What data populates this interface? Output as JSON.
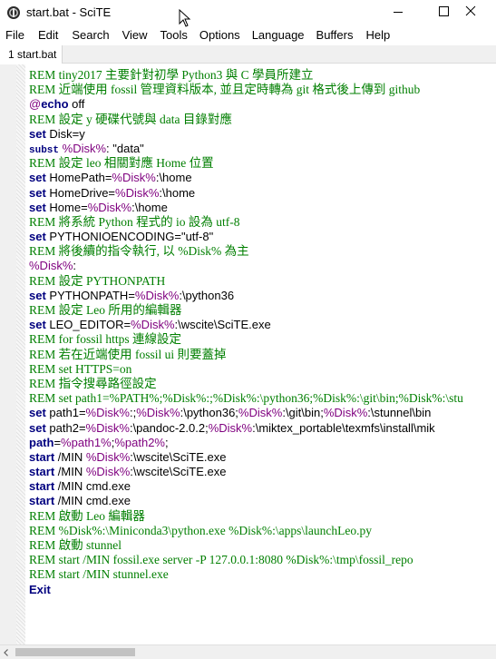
{
  "window": {
    "title": "start.bat - SciTE",
    "app_icon": "scite-app-icon",
    "controls": [
      "minimize-icon",
      "maximize-icon",
      "close-icon"
    ]
  },
  "menu": [
    "File",
    "Edit",
    "Search",
    "View",
    "Tools",
    "Options",
    "Language",
    "Buffers",
    "Help"
  ],
  "tabs": [
    {
      "label": "1 start.bat"
    }
  ],
  "colors": {
    "comment": "#007f00",
    "keyword": "#00007f",
    "variable": "#7f007f",
    "text": "#000000",
    "margin": "#f0f0f0"
  },
  "code_lines": [
    [
      {
        "t": "REM tiny2017 主要針對初學 Python3 與 C 學員所建立",
        "c": "comment"
      }
    ],
    [
      {
        "t": "REM 近端使用 fossil 管理資料版本, 並且定時轉為 git 格式後上傳到 github",
        "c": "comment"
      }
    ],
    [
      {
        "t": "@",
        "c": "var"
      },
      {
        "t": "echo",
        "c": "kw"
      },
      {
        "t": " off",
        "c": "text"
      }
    ],
    [
      {
        "t": "REM 設定 y 硬碟代號與 data 目錄對應",
        "c": "comment"
      }
    ],
    [
      {
        "t": "set",
        "c": "kw"
      },
      {
        "t": " Disk=y",
        "c": "text"
      }
    ],
    [
      {
        "t": "subst",
        "c": "kw2"
      },
      {
        "t": " ",
        "c": "text"
      },
      {
        "t": "%Disk%",
        "c": "var"
      },
      {
        "t": ": \"data\"",
        "c": "text"
      }
    ],
    [
      {
        "t": "REM 設定 leo 相關對應 Home 位置",
        "c": "comment"
      }
    ],
    [
      {
        "t": "set",
        "c": "kw"
      },
      {
        "t": " HomePath=",
        "c": "text"
      },
      {
        "t": "%Disk%",
        "c": "var"
      },
      {
        "t": ":\\home",
        "c": "text"
      }
    ],
    [
      {
        "t": "set",
        "c": "kw"
      },
      {
        "t": " HomeDrive=",
        "c": "text"
      },
      {
        "t": "%Disk%",
        "c": "var"
      },
      {
        "t": ":\\home",
        "c": "text"
      }
    ],
    [
      {
        "t": "set",
        "c": "kw"
      },
      {
        "t": " Home=",
        "c": "text"
      },
      {
        "t": "%Disk%",
        "c": "var"
      },
      {
        "t": ":\\home",
        "c": "text"
      }
    ],
    [
      {
        "t": "REM 將系統 Python 程式的 io 設為 utf-8",
        "c": "comment"
      }
    ],
    [
      {
        "t": "set",
        "c": "kw"
      },
      {
        "t": " PYTHONIOENCODING=\"utf-8\"",
        "c": "text"
      }
    ],
    [
      {
        "t": "REM 將後續的指令執行, 以 %Disk% 為主",
        "c": "comment"
      }
    ],
    [
      {
        "t": "%Disk%",
        "c": "var"
      },
      {
        "t": ":",
        "c": "text"
      }
    ],
    [
      {
        "t": "REM 設定 PYTHONPATH",
        "c": "comment"
      }
    ],
    [
      {
        "t": "set",
        "c": "kw"
      },
      {
        "t": " PYTHONPATH=",
        "c": "text"
      },
      {
        "t": "%Disk%",
        "c": "var"
      },
      {
        "t": ":\\python36",
        "c": "text"
      }
    ],
    [
      {
        "t": "REM 設定 Leo 所用的編輯器",
        "c": "comment"
      }
    ],
    [
      {
        "t": "set",
        "c": "kw"
      },
      {
        "t": " LEO_EDITOR=",
        "c": "text"
      },
      {
        "t": "%Disk%",
        "c": "var"
      },
      {
        "t": ":\\wscite\\SciTE.exe",
        "c": "text"
      }
    ],
    [
      {
        "t": "REM for fossil https 連線設定",
        "c": "comment"
      }
    ],
    [
      {
        "t": "REM 若在近端使用 fossil ui 則要蓋掉",
        "c": "comment"
      }
    ],
    [
      {
        "t": "REM set HTTPS=on",
        "c": "comment"
      }
    ],
    [
      {
        "t": "REM 指令搜尋路徑設定",
        "c": "comment"
      }
    ],
    [
      {
        "t": "REM set path1=%PATH%;%Disk%:;%Disk%:\\python36;%Disk%:\\git\\bin;%Disk%:\\stu",
        "c": "comment"
      }
    ],
    [
      {
        "t": "set",
        "c": "kw"
      },
      {
        "t": " path1=",
        "c": "text"
      },
      {
        "t": "%Disk%",
        "c": "var"
      },
      {
        "t": ":;",
        "c": "text"
      },
      {
        "t": "%Disk%",
        "c": "var"
      },
      {
        "t": ":\\python36;",
        "c": "text"
      },
      {
        "t": "%Disk%",
        "c": "var"
      },
      {
        "t": ":\\git\\bin;",
        "c": "text"
      },
      {
        "t": "%Disk%",
        "c": "var"
      },
      {
        "t": ":\\stunnel\\bin",
        "c": "text"
      }
    ],
    [
      {
        "t": "set",
        "c": "kw"
      },
      {
        "t": " path2=",
        "c": "text"
      },
      {
        "t": "%Disk%",
        "c": "var"
      },
      {
        "t": ":\\pandoc-2.0.2;",
        "c": "text"
      },
      {
        "t": "%Disk%",
        "c": "var"
      },
      {
        "t": ":\\miktex_portable\\texmfs\\install\\mik",
        "c": "text"
      }
    ],
    [
      {
        "t": "path",
        "c": "kw"
      },
      {
        "t": "=",
        "c": "text"
      },
      {
        "t": "%path1%",
        "c": "var"
      },
      {
        "t": ";",
        "c": "text"
      },
      {
        "t": "%path2%",
        "c": "var"
      },
      {
        "t": ";",
        "c": "text"
      }
    ],
    [
      {
        "t": "start",
        "c": "kw"
      },
      {
        "t": " /MIN ",
        "c": "text"
      },
      {
        "t": "%Disk%",
        "c": "var"
      },
      {
        "t": ":\\wscite\\SciTE.exe",
        "c": "text"
      }
    ],
    [
      {
        "t": "start",
        "c": "kw"
      },
      {
        "t": " /MIN ",
        "c": "text"
      },
      {
        "t": "%Disk%",
        "c": "var"
      },
      {
        "t": ":\\wscite\\SciTE.exe",
        "c": "text"
      }
    ],
    [
      {
        "t": "start",
        "c": "kw"
      },
      {
        "t": " /MIN cmd.exe",
        "c": "text"
      }
    ],
    [
      {
        "t": "start",
        "c": "kw"
      },
      {
        "t": " /MIN cmd.exe",
        "c": "text"
      }
    ],
    [
      {
        "t": "REM 啟動 Leo 編輯器",
        "c": "comment"
      }
    ],
    [
      {
        "t": "REM %Disk%:\\Miniconda3\\python.exe %Disk%:\\apps\\launchLeo.py",
        "c": "comment"
      }
    ],
    [
      {
        "t": "REM 啟動 stunnel",
        "c": "comment"
      }
    ],
    [
      {
        "t": "REM start /MIN fossil.exe server -P 127.0.0.1:8080 %Disk%:\\tmp\\fossil_repo",
        "c": "comment"
      }
    ],
    [
      {
        "t": "REM start /MIN stunnel.exe",
        "c": "comment"
      }
    ],
    [
      {
        "t": "Exit",
        "c": "kw"
      }
    ]
  ]
}
